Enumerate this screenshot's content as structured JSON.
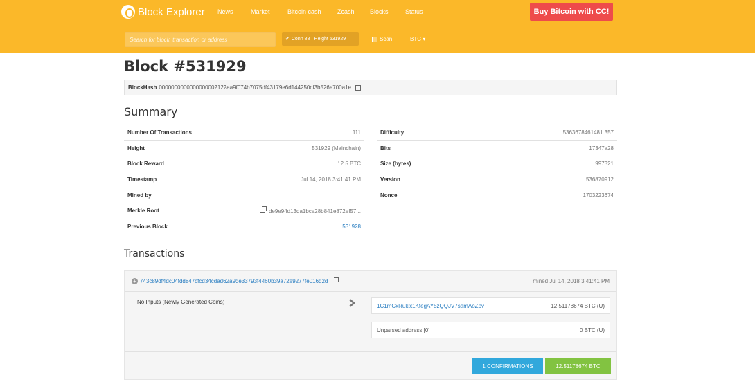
{
  "header": {
    "logo_text": "Block Explorer",
    "nav": [
      "News",
      "Market",
      "Bitcoin cash",
      "Zcash",
      "Blocks",
      "Status"
    ],
    "buy_button": "Buy Bitcoin with CC!",
    "search_placeholder": "Search for block, transaction or address",
    "status_pill": "Conn 88 · Height 531929",
    "scan_label": "Scan",
    "currency_select": "BTC ▾",
    "colors": {
      "bar": "#fbb829",
      "buy": "#ee4b4b"
    }
  },
  "block": {
    "title": "Block #531929",
    "hash_label": "BlockHash",
    "hash_value": "0000000000000000002122aa9f074b7075df43179e6d144250cf3b526e700a1e"
  },
  "summary": {
    "title": "Summary",
    "left": [
      {
        "key": "Number Of Transactions",
        "value": "111"
      },
      {
        "key": "Height",
        "value": "531929 (Mainchain)"
      },
      {
        "key": "Block Reward",
        "value": "12.5 BTC"
      },
      {
        "key": "Timestamp",
        "value": "Jul 14, 2018 3:41:41 PM"
      },
      {
        "key": "Mined by",
        "value": ""
      },
      {
        "key": "Merkle Root",
        "value": "de9e94d13da1bce28b841e872ef57..."
      },
      {
        "key": "Previous Block",
        "value": "531928"
      }
    ],
    "right": [
      {
        "key": "Difficulty",
        "value": "5363678461481.357"
      },
      {
        "key": "Bits",
        "value": "17347a28"
      },
      {
        "key": "Size (bytes)",
        "value": "997321"
      },
      {
        "key": "Version",
        "value": "536870912"
      },
      {
        "key": "Nonce",
        "value": "1703223674"
      }
    ]
  },
  "transactions": {
    "title": "Transactions",
    "tx_id": "743c89df4dc04fdd847cfcd34cdad62a9de33793f4460b39a72e9277fe016d2d",
    "mined": "mined Jul 14, 2018 3:41:41 PM",
    "inputs_label": "No Inputs (Newly Generated Coins)",
    "outputs": [
      {
        "address": "1C1mCxRukix1KfegAY5zQQJV7samAoZpv",
        "amount": "12.51178674 BTC (U)"
      },
      {
        "address": "Unparsed address [0]",
        "amount": "0 BTC (U)"
      }
    ],
    "confirmations": "1 CONFIRMATIONS",
    "total": "12.51178674 BTC"
  }
}
